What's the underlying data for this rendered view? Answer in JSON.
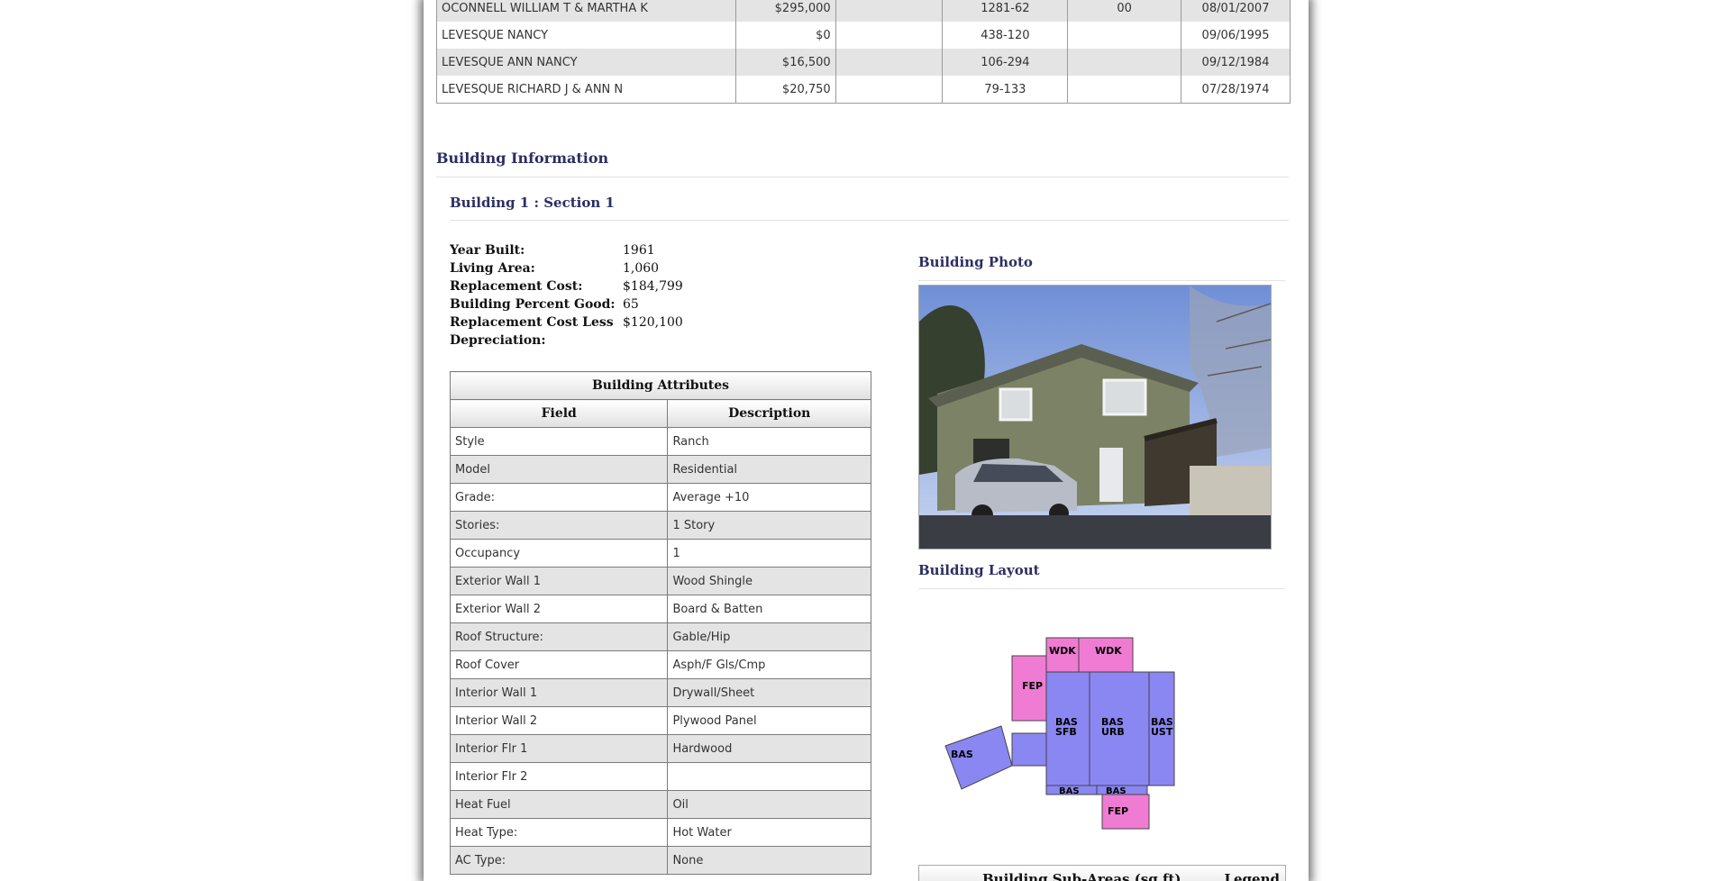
{
  "sales_history": {
    "rows": [
      {
        "owner": "OCONNELL WILLIAM T & MARTHA K",
        "price": "$295,000",
        "cert": "",
        "book_page": "1281-62",
        "instr": "00",
        "date": "08/01/2007"
      },
      {
        "owner": "LEVESQUE NANCY",
        "price": "$0",
        "cert": "",
        "book_page": "438-120",
        "instr": "",
        "date": "09/06/1995"
      },
      {
        "owner": "LEVESQUE ANN NANCY",
        "price": "$16,500",
        "cert": "",
        "book_page": "106-294",
        "instr": "",
        "date": "09/12/1984"
      },
      {
        "owner": "LEVESQUE RICHARD J & ANN N",
        "price": "$20,750",
        "cert": "",
        "book_page": "79-133",
        "instr": "",
        "date": "07/28/1974"
      }
    ]
  },
  "building_info": {
    "title": "Building Information",
    "section_title": "Building 1 : Section 1",
    "facts": [
      {
        "label": "Year Built:",
        "value": "1961"
      },
      {
        "label": "Living Area:",
        "value": "1,060"
      },
      {
        "label": "Replacement Cost:",
        "value": "$184,799"
      },
      {
        "label": "Building Percent Good:",
        "value": "65"
      },
      {
        "label": "Replacement Cost Less Depreciation:",
        "value": "$120,100"
      }
    ]
  },
  "attributes": {
    "title": "Building Attributes",
    "col_field": "Field",
    "col_desc": "Description",
    "rows": [
      {
        "field": "Style",
        "desc": "Ranch"
      },
      {
        "field": "Model",
        "desc": "Residential"
      },
      {
        "field": "Grade:",
        "desc": "Average +10"
      },
      {
        "field": "Stories:",
        "desc": "1 Story"
      },
      {
        "field": "Occupancy",
        "desc": "1"
      },
      {
        "field": "Exterior Wall 1",
        "desc": "Wood Shingle"
      },
      {
        "field": "Exterior Wall 2",
        "desc": "Board & Batten"
      },
      {
        "field": "Roof Structure:",
        "desc": "Gable/Hip"
      },
      {
        "field": "Roof Cover",
        "desc": "Asph/F Gls/Cmp"
      },
      {
        "field": "Interior Wall 1",
        "desc": "Drywall/Sheet"
      },
      {
        "field": "Interior Wall 2",
        "desc": "Plywood Panel"
      },
      {
        "field": "Interior Flr 1",
        "desc": "Hardwood"
      },
      {
        "field": "Interior Flr 2",
        "desc": ""
      },
      {
        "field": "Heat Fuel",
        "desc": "Oil"
      },
      {
        "field": "Heat Type:",
        "desc": "Hot Water"
      },
      {
        "field": "AC Type:",
        "desc": "None"
      }
    ]
  },
  "photo": {
    "title": "Building Photo"
  },
  "layout": {
    "title": "Building Layout",
    "labels": {
      "wdk1": "WDK",
      "wdk2": "WDK",
      "fep1": "FEP",
      "fep2": "FEP",
      "bas_sfb": "BAS\nSFB",
      "bas_urb": "BAS\nURB",
      "bas_ust": "BAS\nUST",
      "bas_left": "BAS",
      "bas_b1": "BAS",
      "bas_b2": "BAS"
    }
  },
  "subareas": {
    "title": "Building Sub-Areas (sq ft)",
    "legend_link": "Legend"
  },
  "colors": {
    "heading": "#2c2e63",
    "bas": "#8a86f2",
    "fep": "#f07bd3",
    "row_alt": "#e4e4e4"
  }
}
